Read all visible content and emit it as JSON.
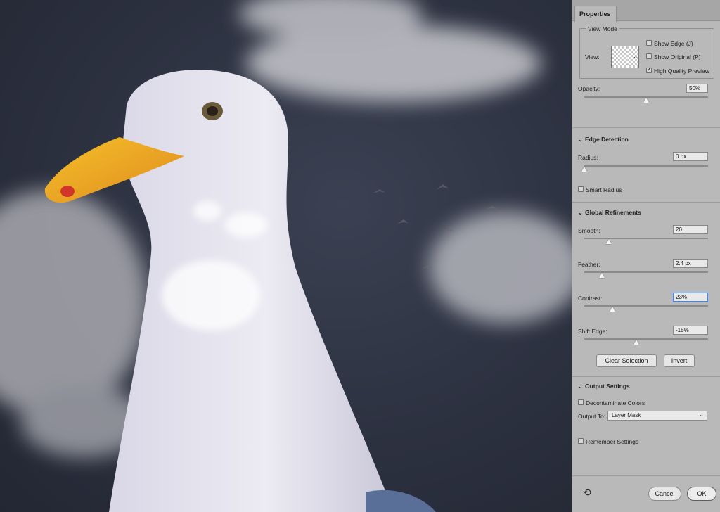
{
  "panel": {
    "tab_label": "Properties",
    "view_mode": {
      "legend": "View Mode",
      "view_label": "View:",
      "show_edge": {
        "label": "Show Edge (J)",
        "checked": false
      },
      "show_original": {
        "label": "Show Original (P)",
        "checked": false
      },
      "high_quality_preview": {
        "label": "High Quality Preview",
        "checked": true
      }
    },
    "opacity": {
      "label": "Opacity:",
      "value": "50%",
      "slider_percent": 50
    },
    "edge_detection": {
      "title": "Edge Detection",
      "radius": {
        "label": "Radius:",
        "value": "0 px",
        "slider_percent": 0
      },
      "smart_radius": {
        "label": "Smart Radius",
        "checked": false
      }
    },
    "global_refinements": {
      "title": "Global Refinements",
      "smooth": {
        "label": "Smooth:",
        "value": "20",
        "slider_percent": 20
      },
      "feather": {
        "label": "Feather:",
        "value": "2.4 px",
        "slider_percent": 14
      },
      "contrast": {
        "label": "Contrast:",
        "value": "23%",
        "slider_percent": 23
      },
      "shift_edge": {
        "label": "Shift Edge:",
        "value": "-15%",
        "slider_percent": 42
      },
      "clear_selection_label": "Clear Selection",
      "invert_label": "Invert"
    },
    "output_settings": {
      "title": "Output Settings",
      "decontaminate": {
        "label": "Decontaminate Colors",
        "checked": false
      },
      "output_to_label": "Output To:",
      "output_to_value": "Layer Mask"
    },
    "remember_settings": {
      "label": "Remember Settings",
      "checked": false
    },
    "cancel_label": "Cancel",
    "ok_label": "OK"
  },
  "icons": {
    "reset": "reset-icon",
    "chevron": "chevron-down-icon"
  },
  "colors": {
    "panel_bg": "#b9b9b9",
    "focus_blue": "#4a84d8"
  }
}
